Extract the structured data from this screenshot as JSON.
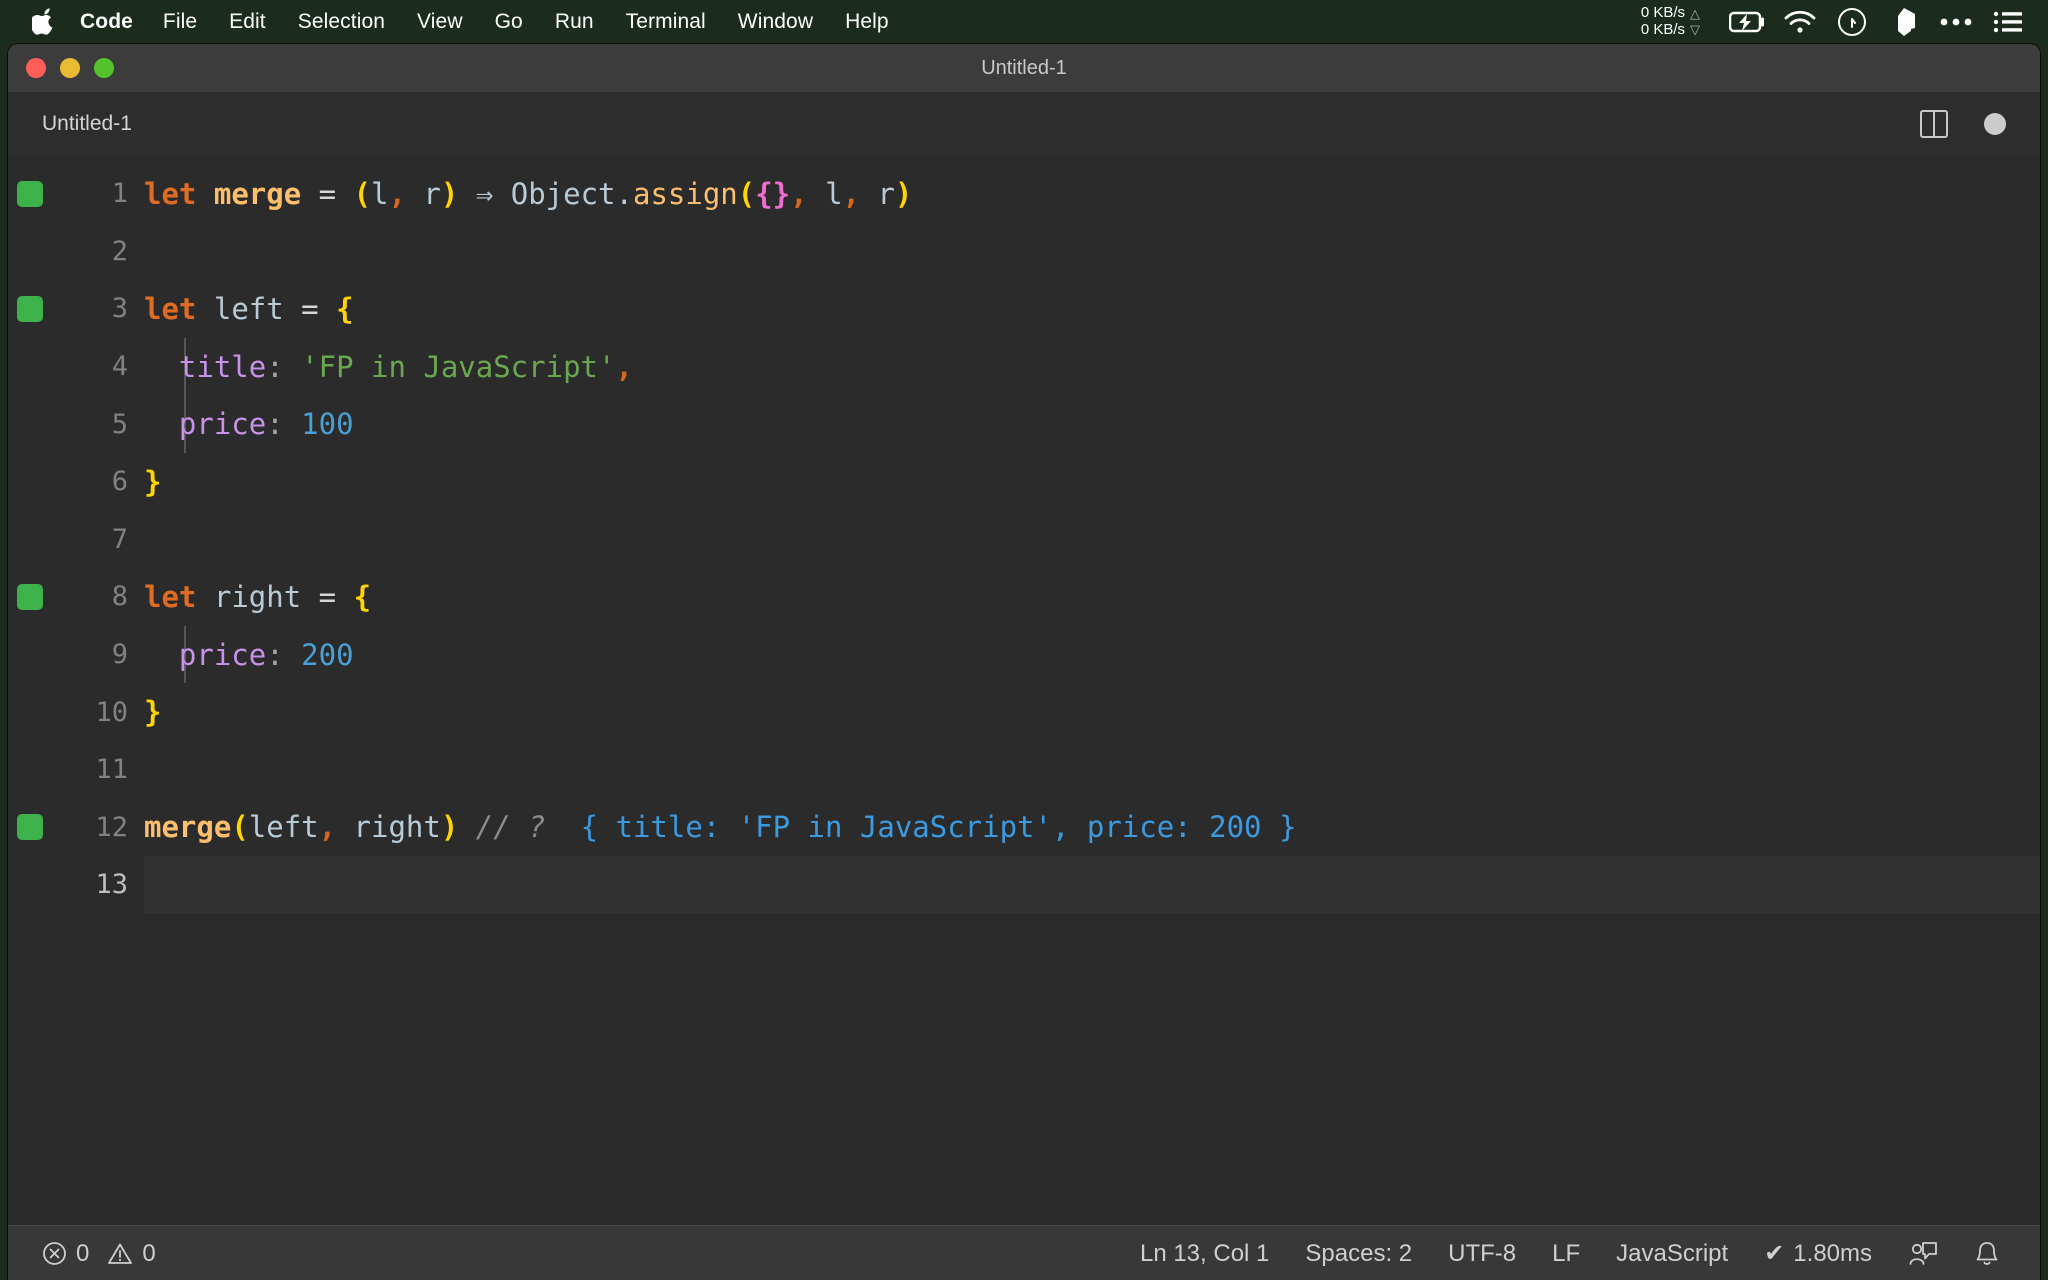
{
  "menubar": {
    "apple_icon": "apple-logo-icon",
    "items": [
      {
        "label": "Code",
        "bold": true
      },
      {
        "label": "File",
        "bold": false
      },
      {
        "label": "Edit",
        "bold": false
      },
      {
        "label": "Selection",
        "bold": false
      },
      {
        "label": "View",
        "bold": false
      },
      {
        "label": "Go",
        "bold": false
      },
      {
        "label": "Run",
        "bold": false
      },
      {
        "label": "Terminal",
        "bold": false
      },
      {
        "label": "Window",
        "bold": false
      },
      {
        "label": "Help",
        "bold": false
      }
    ],
    "network": {
      "upload": "0 KB/s",
      "download": "0 KB/s",
      "up_arrow": "△",
      "down_arrow": "▽"
    },
    "tray": [
      "battery-charging-icon",
      "wifi-icon",
      "control-center-icon",
      "app-icon",
      "more-icon",
      "list-menu-icon"
    ]
  },
  "window": {
    "title": "Untitled-1",
    "traffic_lights": [
      "close-button",
      "minimize-button",
      "maximize-button"
    ]
  },
  "tabbar": {
    "tabs": [
      {
        "label": "Untitled-1",
        "active": true
      }
    ],
    "split_editor_label": "split-editor-right",
    "unsaved_indicator": "unsaved-dot"
  },
  "editor": {
    "lines": [
      {
        "num": "1",
        "covered": true,
        "indent_guide": false,
        "current": false
      },
      {
        "num": "2",
        "covered": false,
        "indent_guide": false,
        "current": false
      },
      {
        "num": "3",
        "covered": true,
        "indent_guide": false,
        "current": false
      },
      {
        "num": "4",
        "covered": false,
        "indent_guide": true,
        "current": false
      },
      {
        "num": "5",
        "covered": false,
        "indent_guide": true,
        "current": false
      },
      {
        "num": "6",
        "covered": false,
        "indent_guide": false,
        "current": false
      },
      {
        "num": "7",
        "covered": false,
        "indent_guide": false,
        "current": false
      },
      {
        "num": "8",
        "covered": true,
        "indent_guide": false,
        "current": false
      },
      {
        "num": "9",
        "covered": false,
        "indent_guide": true,
        "current": false
      },
      {
        "num": "10",
        "covered": false,
        "indent_guide": false,
        "current": false
      },
      {
        "num": "11",
        "covered": false,
        "indent_guide": false,
        "current": false
      },
      {
        "num": "12",
        "covered": true,
        "indent_guide": false,
        "current": false
      },
      {
        "num": "13",
        "covered": false,
        "indent_guide": false,
        "current": true
      }
    ],
    "source_text": [
      "let merge = (l, r) ⇒ Object.assign({}, l, r)",
      "",
      "let left = {",
      "  title: 'FP in JavaScript',",
      "  price: 100",
      "}",
      "",
      "let right = {",
      "  price: 200",
      "}",
      "",
      "merge(left, right) // ?  { title: 'FP in JavaScript', price: 200 }",
      ""
    ]
  },
  "statusbar": {
    "errors_icon": "error-circle-icon",
    "errors_count": "0",
    "warnings_icon": "warning-triangle-icon",
    "warnings_count": "0",
    "cursor_position": "Ln 13, Col 1",
    "indentation": "Spaces: 2",
    "encoding": "UTF-8",
    "eol": "LF",
    "language": "JavaScript",
    "quokka_check": "✔",
    "quokka_time": "1.80ms",
    "feedback_icon": "feedback-person-icon",
    "notifications_icon": "bell-icon"
  },
  "colors": {
    "menubar_bg": "#1b2c1e",
    "titlebar_bg": "#3c3c3c",
    "editor_bg": "#2b2b2b",
    "statusbar_bg": "#383838",
    "coverage_green": "#3eb24a",
    "result_blue": "#3b9ae0"
  }
}
